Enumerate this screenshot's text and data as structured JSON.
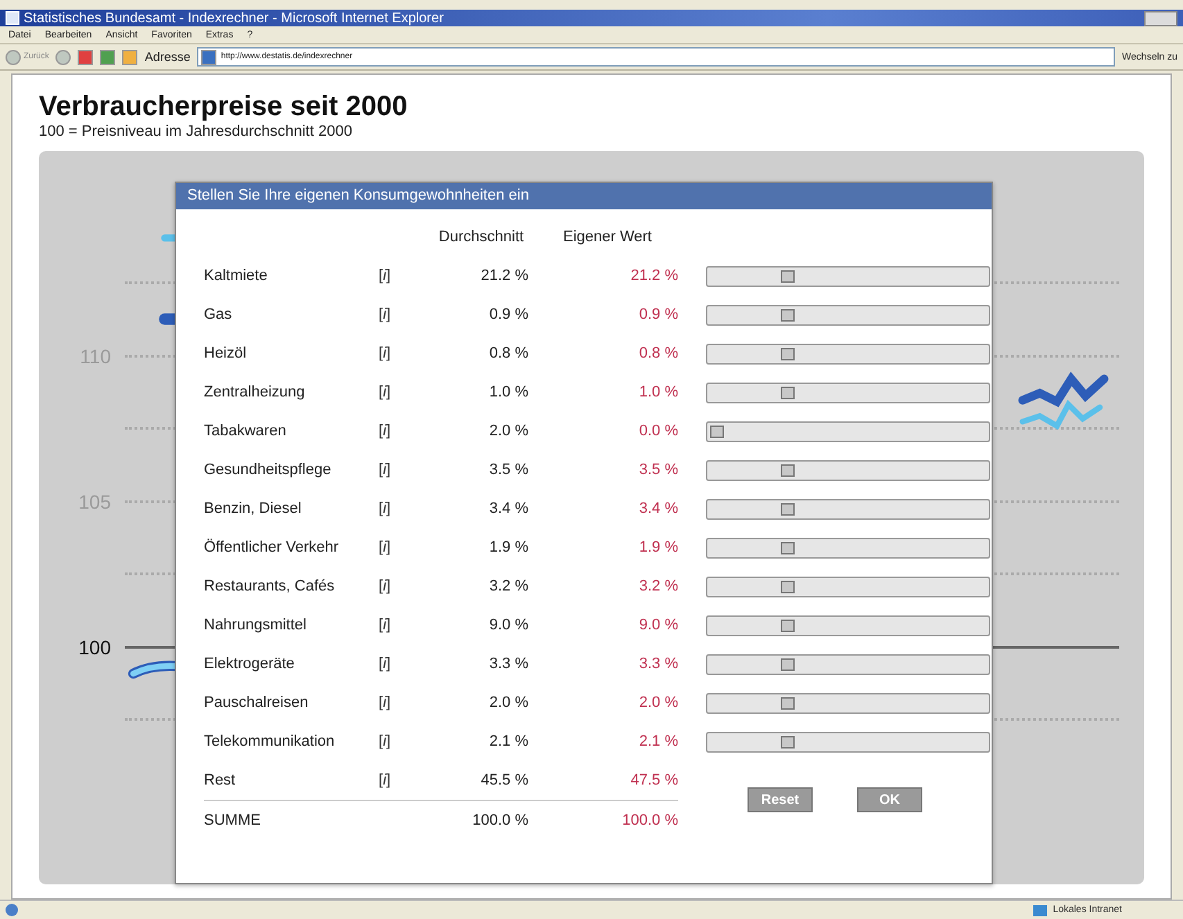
{
  "window": {
    "title": "Statistisches Bundesamt - Indexrechner - Microsoft Internet Explorer"
  },
  "menu": [
    "Datei",
    "Bearbeiten",
    "Ansicht",
    "Favoriten",
    "Extras",
    "?"
  ],
  "toolbar": {
    "back": "Zurück",
    "address_label": "Adresse",
    "url": "http://www.destatis.de/indexrechner",
    "go": "Wechseln zu"
  },
  "page": {
    "heading": "Verbraucherpreise seit 2000",
    "subheading": "100 = Preisniveau im Jahresdurchschnitt 2000"
  },
  "chart_gridlines": [
    {
      "kind": "minor"
    },
    {
      "kind": "major",
      "label": "110"
    },
    {
      "kind": "minor"
    },
    {
      "kind": "major",
      "label": "105"
    },
    {
      "kind": "minor"
    },
    {
      "kind": "base",
      "label": "100"
    },
    {
      "kind": "minor"
    }
  ],
  "dialog": {
    "title": "Stellen Sie Ihre eigenen Konsumgewohnheiten ein",
    "columns": [
      "Durchschnitt",
      "Eigener Wert"
    ],
    "rows": [
      {
        "kind": "slider",
        "name": "Kaltmiete",
        "info": "[*i*]",
        "average": "21.2 %",
        "own": "21.2 %",
        "level": 0.27
      },
      {
        "kind": "slider",
        "name": "Gas",
        "info": "[*i*]",
        "average": "0.9 %",
        "own": "0.9 %",
        "level": 0.27
      },
      {
        "kind": "slider",
        "name": "Heizöl",
        "info": "[*i*]",
        "average": "0.8 %",
        "own": "0.8 %",
        "level": 0.27
      },
      {
        "kind": "slider",
        "name": "Zentralheizung",
        "info": "[*i*]",
        "average": "1.0 %",
        "own": "1.0 %",
        "level": 0.27
      },
      {
        "kind": "slider",
        "name": "Tabakwaren",
        "info": "[*i*]",
        "average": "2.0 %",
        "own": "0.0 %",
        "level": 0
      },
      {
        "kind": "slider",
        "name": "Gesundheitspflege",
        "info": "[*i*]",
        "average": "3.5 %",
        "own": "3.5 %",
        "level": 0.27
      },
      {
        "kind": "slider",
        "name": "Benzin, Diesel",
        "info": "[*i*]",
        "average": "3.4 %",
        "own": "3.4 %",
        "level": 0.27
      },
      {
        "kind": "slider",
        "name": "Öffentlicher Verkehr",
        "info": "[*i*]",
        "average": "1.9 %",
        "own": "1.9 %",
        "level": 0.27
      },
      {
        "kind": "slider",
        "name": "Restaurants, Cafés",
        "info": "[*i*]",
        "average": "3.2 %",
        "own": "3.2 %",
        "level": 0.27
      },
      {
        "kind": "slider",
        "name": "Nahrungsmittel",
        "info": "[*i*]",
        "average": "9.0 %",
        "own": "9.0 %",
        "level": 0.27
      },
      {
        "kind": "slider",
        "name": "Elektrogeräte",
        "info": "[*i*]",
        "average": "3.3 %",
        "own": "3.3 %",
        "level": 0.27
      },
      {
        "kind": "slider",
        "name": "Pauschalreisen",
        "info": "[*i*]",
        "average": "2.0 %",
        "own": "2.0 %",
        "level": 0.27
      },
      {
        "kind": "slider",
        "name": "Telekommunikation",
        "info": "[*i*]",
        "average": "2.1 %",
        "own": "2.1 %",
        "level": 0.27
      },
      {
        "kind": "plain",
        "name": "Rest",
        "info": "[*i*]",
        "average": "45.5 %",
        "own": "47.5 %"
      }
    ],
    "total": {
      "name": "SUMME",
      "average": "100.0 %",
      "own": "100.0 %"
    },
    "buttons": [
      "Reset",
      "OK"
    ]
  },
  "status_bar": {
    "zone": "Lokales Intranet"
  }
}
